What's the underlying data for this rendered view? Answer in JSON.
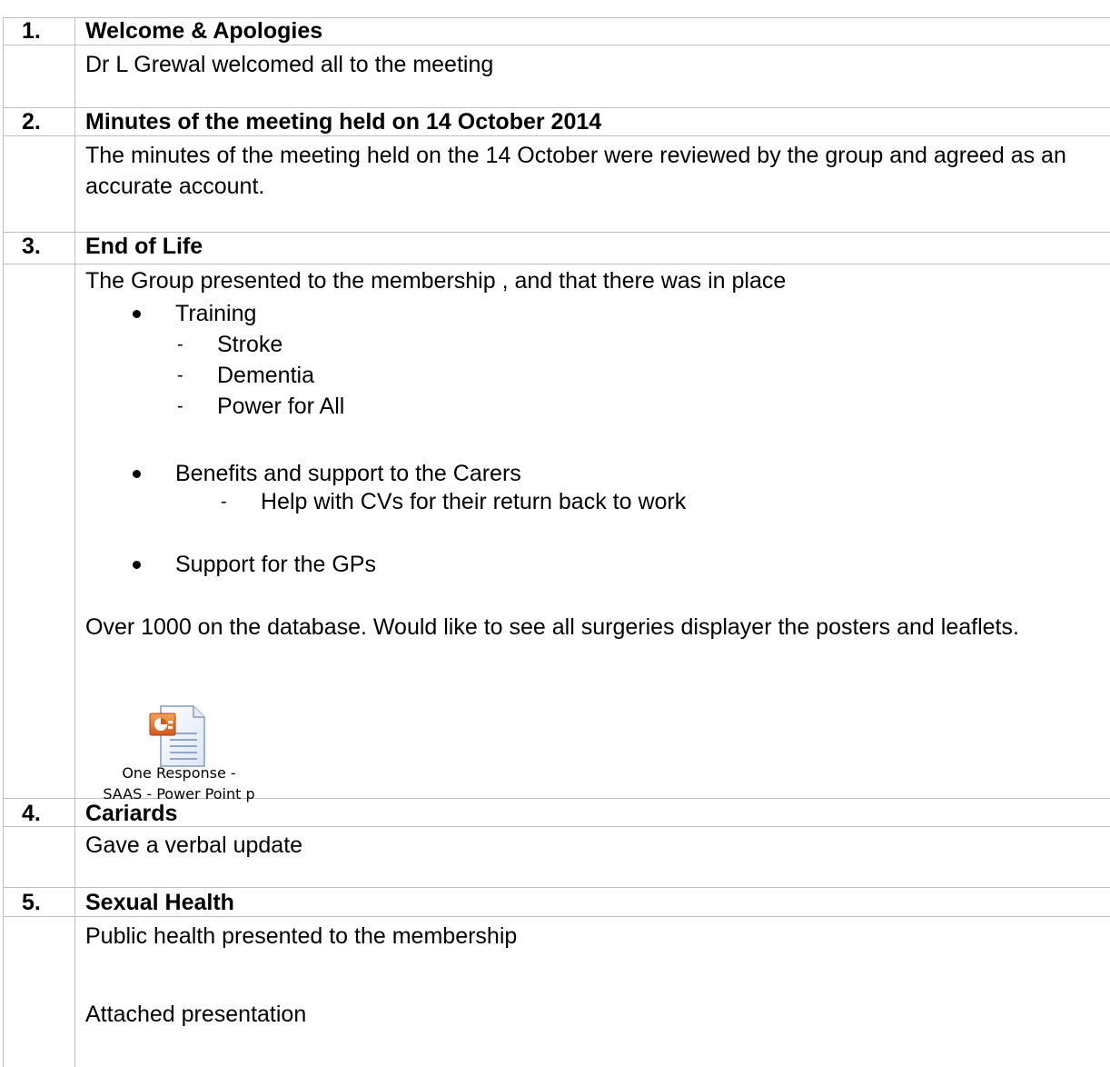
{
  "sections": [
    {
      "num": "1.",
      "heading": "Welcome & Apologies",
      "body": "Dr L Grewal welcomed all to the meeting"
    },
    {
      "num": "2.",
      "heading": "Minutes of the meeting held on 14 October 2014",
      "body": "The minutes of the meeting held on the 14 October were reviewed by the group and agreed as an accurate account."
    },
    {
      "num": "3.",
      "heading": "End of Life",
      "intro": "The Group presented to the membership , and that there was in place",
      "bullets": [
        {
          "label": "Training",
          "subs": [
            "Stroke",
            "Dementia",
            "Power for All"
          ]
        },
        {
          "label": "Benefits and support to the Carers",
          "subs": [
            "Help with CVs for their return back to work"
          ]
        },
        {
          "label": "Support for the GPs",
          "subs": []
        }
      ],
      "closing": "Over 1000 on the database.  Would like to see all surgeries displayer the posters and leaflets.",
      "attachment": {
        "icon": "powerpoint-file-icon",
        "caption_line1": "One Response -",
        "caption_line2": "SAAS - Power Point p"
      }
    },
    {
      "num": "4.",
      "heading": "Cariards",
      "body": "Gave a verbal update"
    },
    {
      "num": "5.",
      "heading": "Sexual Health",
      "body": "Public health presented to the membership",
      "body2": "Attached presentation"
    }
  ]
}
